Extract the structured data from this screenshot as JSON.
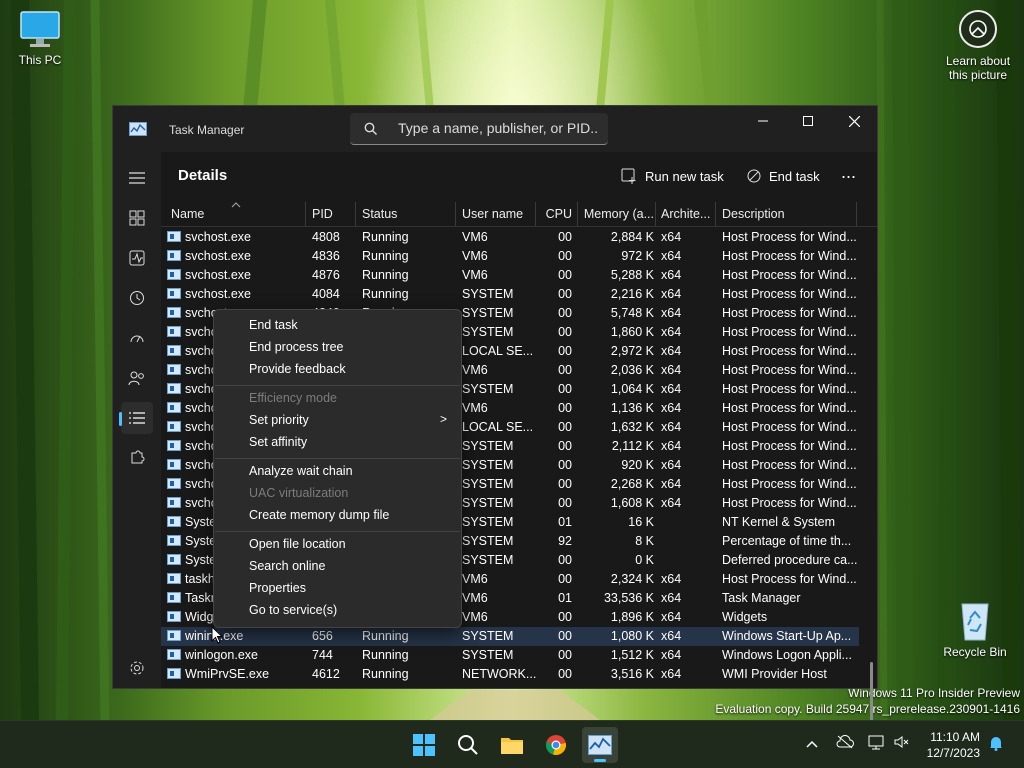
{
  "desktop": {
    "icons": [
      {
        "label": "This PC"
      },
      {
        "label": "Recycle Bin"
      }
    ],
    "learn_label_1": "Learn about",
    "learn_label_2": "this picture",
    "watermark_line1": "Windows 11 Pro Insider Preview",
    "watermark_line2": "Evaluation copy. Build 25947.rs_prerelease.230901-1416"
  },
  "window": {
    "title": "Task Manager",
    "search_placeholder": "Type a name, publisher, or PID...",
    "page_title": "Details",
    "run_new_task": "Run new task",
    "end_task": "End task",
    "more": "..."
  },
  "table": {
    "columns": [
      "Name",
      "PID",
      "Status",
      "User name",
      "CPU",
      "Memory (a...",
      "Archite...",
      "Description"
    ],
    "rows": [
      [
        "svchost.exe",
        "4808",
        "Running",
        "VM6",
        "00",
        "2,884 K",
        "x64",
        "Host Process for Wind..."
      ],
      [
        "svchost.exe",
        "4836",
        "Running",
        "VM6",
        "00",
        "972 K",
        "x64",
        "Host Process for Wind..."
      ],
      [
        "svchost.exe",
        "4876",
        "Running",
        "VM6",
        "00",
        "5,288 K",
        "x64",
        "Host Process for Wind..."
      ],
      [
        "svchost.exe",
        "4084",
        "Running",
        "SYSTEM",
        "00",
        "2,216 K",
        "x64",
        "Host Process for Wind..."
      ],
      [
        "svchost.exe",
        "4240",
        "Running",
        "SYSTEM",
        "00",
        "5,748 K",
        "x64",
        "Host Process for Wind..."
      ],
      [
        "svcho",
        "",
        "",
        "SYSTEM",
        "00",
        "1,860 K",
        "x64",
        "Host Process for Wind..."
      ],
      [
        "svcho",
        "",
        "",
        "LOCAL SE...",
        "00",
        "2,972 K",
        "x64",
        "Host Process for Wind..."
      ],
      [
        "svcho",
        "",
        "",
        "VM6",
        "00",
        "2,036 K",
        "x64",
        "Host Process for Wind..."
      ],
      [
        "svcho",
        "",
        "",
        "SYSTEM",
        "00",
        "1,064 K",
        "x64",
        "Host Process for Wind..."
      ],
      [
        "svcho",
        "",
        "",
        "VM6",
        "00",
        "1,136 K",
        "x64",
        "Host Process for Wind..."
      ],
      [
        "svcho",
        "",
        "",
        "LOCAL SE...",
        "00",
        "1,632 K",
        "x64",
        "Host Process for Wind..."
      ],
      [
        "svcho",
        "",
        "",
        "SYSTEM",
        "00",
        "2,112 K",
        "x64",
        "Host Process for Wind..."
      ],
      [
        "svcho",
        "",
        "",
        "SYSTEM",
        "00",
        "920 K",
        "x64",
        "Host Process for Wind..."
      ],
      [
        "svcho",
        "",
        "",
        "SYSTEM",
        "00",
        "2,268 K",
        "x64",
        "Host Process for Wind..."
      ],
      [
        "svcho",
        "",
        "",
        "SYSTEM",
        "00",
        "1,608 K",
        "x64",
        "Host Process for Wind..."
      ],
      [
        "Syste",
        "",
        "",
        "SYSTEM",
        "01",
        "16 K",
        "",
        "NT Kernel & System"
      ],
      [
        "Syste",
        "",
        "",
        "SYSTEM",
        "92",
        "8 K",
        "",
        "Percentage of time th..."
      ],
      [
        "Syste",
        "",
        "",
        "SYSTEM",
        "00",
        "0 K",
        "",
        "Deferred procedure ca..."
      ],
      [
        "taskh",
        "",
        "",
        "VM6",
        "00",
        "2,324 K",
        "x64",
        "Host Process for Wind..."
      ],
      [
        "Taskn",
        "",
        "",
        "VM6",
        "01",
        "33,536 K",
        "x64",
        "Task Manager"
      ],
      [
        "Widg",
        "",
        "",
        "VM6",
        "00",
        "1,896 K",
        "x64",
        "Widgets"
      ],
      [
        "wininit.exe",
        "656",
        "Running",
        "SYSTEM",
        "00",
        "1,080 K",
        "x64",
        "Windows Start-Up Ap..."
      ],
      [
        "winlogon.exe",
        "744",
        "Running",
        "SYSTEM",
        "00",
        "1,512 K",
        "x64",
        "Windows Logon Appli..."
      ],
      [
        "WmiPrvSE.exe",
        "4612",
        "Running",
        "NETWORK...",
        "00",
        "3,516 K",
        "x64",
        "WMI Provider Host"
      ]
    ]
  },
  "context_menu": {
    "items": [
      {
        "label": "End task",
        "enabled": true
      },
      {
        "label": "End process tree",
        "enabled": true
      },
      {
        "label": "Provide feedback",
        "enabled": true
      },
      {
        "label": "Efficiency mode",
        "enabled": false
      },
      {
        "label": "Set priority",
        "enabled": true,
        "submenu": ">"
      },
      {
        "label": "Set affinity",
        "enabled": true
      },
      {
        "label": "Analyze wait chain",
        "enabled": true
      },
      {
        "label": "UAC virtualization",
        "enabled": false
      },
      {
        "label": "Create memory dump file",
        "enabled": true
      },
      {
        "label": "Open file location",
        "enabled": true
      },
      {
        "label": "Search online",
        "enabled": true
      },
      {
        "label": "Properties",
        "enabled": true
      },
      {
        "label": "Go to service(s)",
        "enabled": true
      }
    ]
  },
  "taskbar": {
    "time": "11:10 AM",
    "date": "12/7/2023"
  },
  "colors": {
    "accent": "#4cc2ff",
    "window_bg": "#1c1c1c",
    "menu_bg": "#2b2b2b",
    "selection": "#253448"
  }
}
